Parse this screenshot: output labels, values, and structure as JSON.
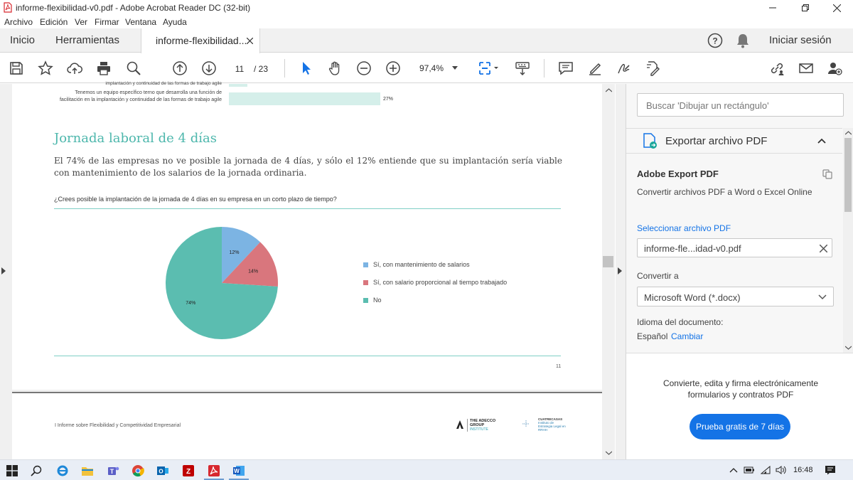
{
  "window": {
    "title": "informe-flexibilidad-v0.pdf - Adobe Acrobat Reader DC (32-bit)"
  },
  "menu": [
    "Archivo",
    "Edición",
    "Ver",
    "Firmar",
    "Ventana",
    "Ayuda"
  ],
  "tabs": {
    "home": "Inicio",
    "tools": "Herramientas",
    "document": "informe-flexibilidad...",
    "signin": "Iniciar sesión"
  },
  "toolbar": {
    "page_current": "11",
    "page_total": "/ 23",
    "zoom": "97,4%"
  },
  "document": {
    "top_bar_label": "Tenemos un equipo específico terno que desarrolla una función de facilitación en la implantación y continuidad de las formas de trabajo agile",
    "top_bar_prev_label": "implantación y continuidad de las formas de trabajo agile",
    "top_bar_value": "27%",
    "heading": "Jornada laboral de 4 días",
    "paragraph": "El 74% de las empresas no ve posible la jornada de 4 días, y sólo el 12% entiende que su implantación sería viable con mantenimiento de los salarios de la jornada ordinaria.",
    "question": "¿Crees posible la implantación de la jornada de 4 días en su empresa en un corto plazo de tiempo?",
    "page_number": "11",
    "footer_text": "I Informe sobre Flexibilidad y Competitividad Empresarial",
    "footer_logo_1": "THE ADECCO GROUP",
    "footer_logo_1_sub": "INSTITUTE",
    "footer_logo_2": "CUATRECASAS",
    "footer_logo_2_sub": "Instituto de Estrategia Legal en RRHH"
  },
  "chart_data": {
    "type": "pie",
    "categories": [
      "Sí, con mantenimiento de salarios",
      "Sí, con salario proporcional al tiempo trabajado",
      "No"
    ],
    "values": [
      12,
      14,
      74
    ],
    "labels": [
      "12%",
      "14%",
      "74%"
    ],
    "colors": [
      "#7cb4e3",
      "#d9767d",
      "#5bbdb0"
    ],
    "legend_position": "right"
  },
  "right_panel": {
    "search_placeholder": "Buscar 'Dibujar un rectángulo'",
    "export_title": "Exportar archivo PDF",
    "adobe_export": "Adobe Export PDF",
    "convert_desc": "Convertir archivos PDF a Word o Excel Online",
    "select_file": "Seleccionar archivo PDF",
    "file_name": "informe-fle...idad-v0.pdf",
    "convert_to": "Convertir a",
    "format": "Microsoft Word (*.docx)",
    "doc_language_label": "Idioma del documento:",
    "language": "Español",
    "change": "Cambiar",
    "promo_text": "Convierte, edita y firma electrónicamente formularios y contratos PDF",
    "trial_button": "Prueba gratis de 7 días"
  },
  "taskbar": {
    "time": "16:48"
  },
  "colors": {
    "accent_teal": "#5bbdb0",
    "adobe_red": "#d7282f",
    "blue_button": "#1473e6"
  }
}
